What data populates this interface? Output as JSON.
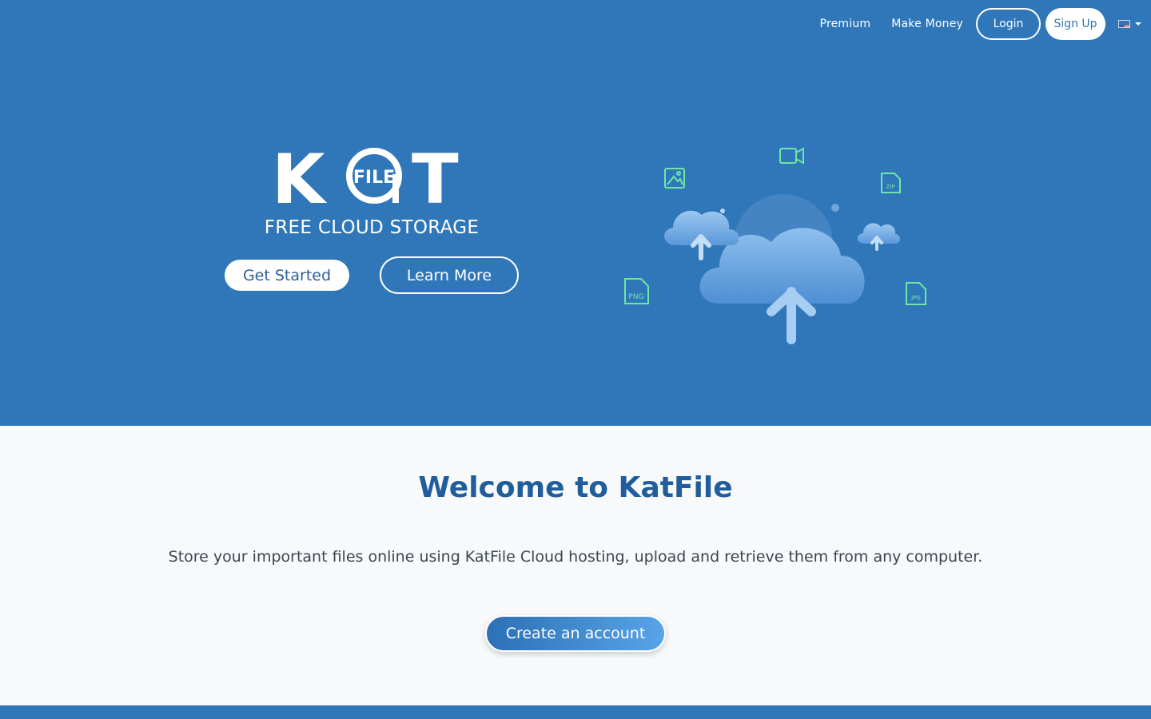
{
  "nav": {
    "premium": "Premium",
    "make_money": "Make Money",
    "login": "Login",
    "signup": "Sign Up",
    "language_icon": "us-flag-icon"
  },
  "hero": {
    "logo_text": "KaT",
    "logo_inner": "FILE",
    "tagline": "FREE CLOUD STORAGE",
    "get_started": "Get Started",
    "learn_more": "Learn More",
    "file_labels": {
      "png": "PNG",
      "zip": "ZIP",
      "jpg": "JPG"
    }
  },
  "welcome": {
    "title": "Welcome to KatFile",
    "text": "Store your important files online using KatFile Cloud hosting, upload and retrieve them from any computer.",
    "create_account": "Create an account"
  },
  "colors": {
    "brand_blue": "#3077b9",
    "title_blue": "#1f5d9c",
    "icon_green": "#6ee6a6",
    "page_bg": "#f7f9fb"
  }
}
